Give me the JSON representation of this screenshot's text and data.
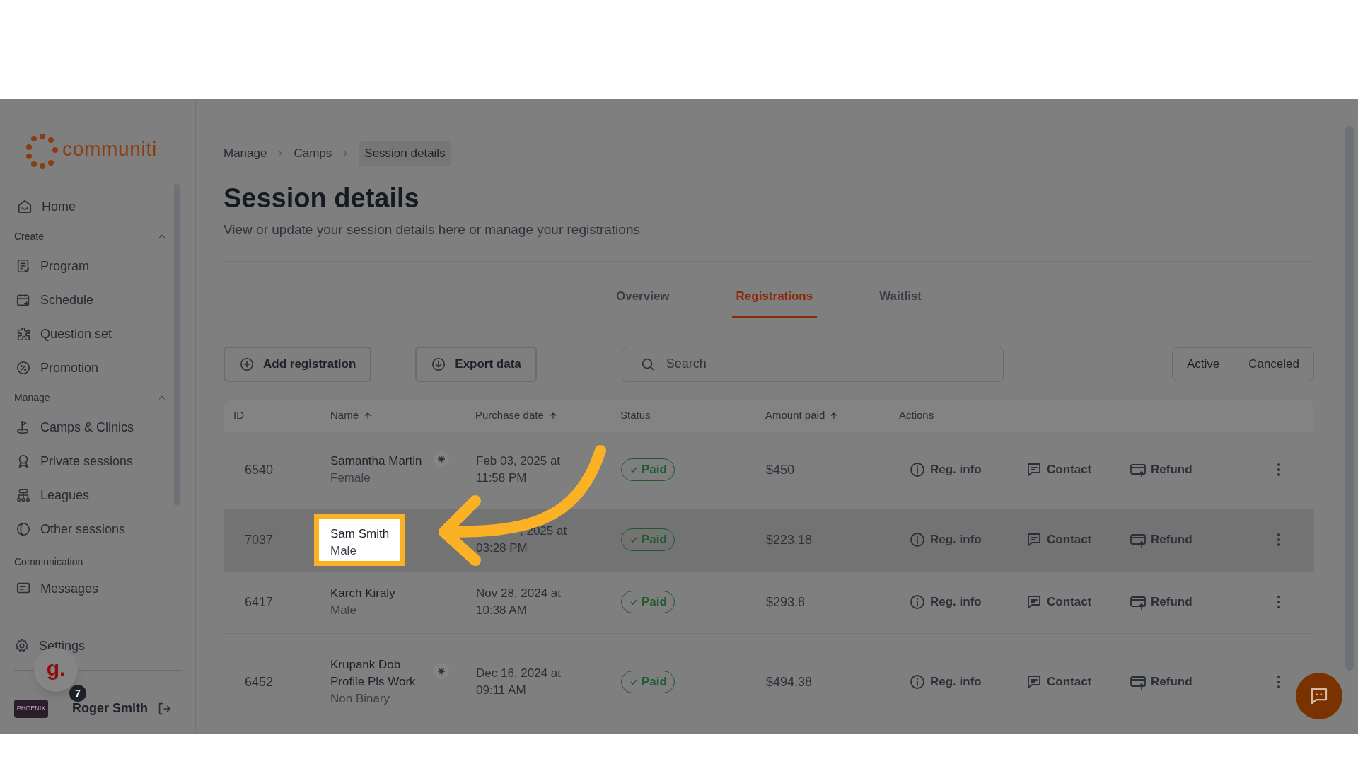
{
  "sidebar": {
    "logo": "communiti",
    "entries": [
      {
        "kind": "item",
        "label": "Home"
      },
      {
        "kind": "section",
        "label": "Create",
        "expanded": true,
        "children": [
          {
            "label": "Program"
          },
          {
            "label": "Schedule"
          },
          {
            "label": "Question set"
          },
          {
            "label": "Promotion"
          }
        ]
      },
      {
        "kind": "section",
        "label": "Manage",
        "expanded": true,
        "children": [
          {
            "label": "Camps & Clinics"
          },
          {
            "label": "Private sessions"
          },
          {
            "label": "Leagues"
          },
          {
            "label": "Other sessions"
          }
        ]
      },
      {
        "kind": "section",
        "label": "Communication",
        "children": [
          {
            "label": "Messages"
          }
        ]
      }
    ],
    "settings": "Settings",
    "user": {
      "name": "Roger Smith",
      "avatar_text": "PHOENIX"
    }
  },
  "breadcrumb": [
    {
      "label": "Manage",
      "current": false
    },
    {
      "label": "Camps",
      "current": false
    },
    {
      "label": "Session details",
      "current": true
    }
  ],
  "title": "Session details",
  "subtitle": "View or update your session details here or manage your registrations",
  "tabs": [
    {
      "label": "Overview",
      "selected": false
    },
    {
      "label": "Registrations",
      "selected": true
    },
    {
      "label": "Waitlist",
      "selected": false
    }
  ],
  "toolbar": {
    "add_button": "Add registration",
    "export_button": "Export data",
    "search": {
      "placeholder": "Search"
    },
    "filters": [
      "Active",
      "Canceled"
    ]
  },
  "table": {
    "columns": [
      {
        "label": "ID",
        "sortable": false
      },
      {
        "label": "Name",
        "sortable": true
      },
      {
        "label": "Purchase date",
        "sortable": true
      },
      {
        "label": "Status",
        "sortable": false
      },
      {
        "label": "Amount paid",
        "sortable": true
      },
      {
        "label": "Actions",
        "sortable": false
      }
    ],
    "rows": [
      {
        "id": "6540",
        "name": "Samantha Martin",
        "gender": "Female",
        "marked": true,
        "highlighted": false,
        "hovered": false,
        "date": "Feb 03, 2025 at",
        "time": "11:58 PM",
        "status": "Paid",
        "amount": "$450",
        "actions": [
          "Reg. info",
          "Contact",
          "Refund"
        ]
      },
      {
        "id": "7037",
        "name": "Sam Smith",
        "gender": "Male",
        "marked": false,
        "highlighted": true,
        "hovered": true,
        "date": ", 2025 at",
        "time": "03:28 PM",
        "status": "Paid",
        "amount": "$223.18",
        "actions": [
          "Reg. info",
          "Contact",
          "Refund"
        ]
      },
      {
        "id": "6417",
        "name": "Karch Kiraly",
        "gender": "Male",
        "marked": false,
        "highlighted": false,
        "hovered": false,
        "date": "Nov 28, 2024 at",
        "time": "10:38 AM",
        "status": "Paid",
        "amount": "$293.8",
        "actions": [
          "Reg. info",
          "Contact",
          "Refund"
        ]
      },
      {
        "id": "6452",
        "name": "Krupank Dob Profile Pls Work",
        "gender": "Non Binary",
        "marked": true,
        "highlighted": false,
        "hovered": false,
        "date": "Dec 16, 2024 at",
        "time": "09:11 AM",
        "status": "Paid",
        "amount": "$494.38",
        "actions": [
          "Reg. info",
          "Contact",
          "Refund"
        ]
      }
    ]
  },
  "widget": {
    "letter": "g.",
    "badge": "7"
  }
}
